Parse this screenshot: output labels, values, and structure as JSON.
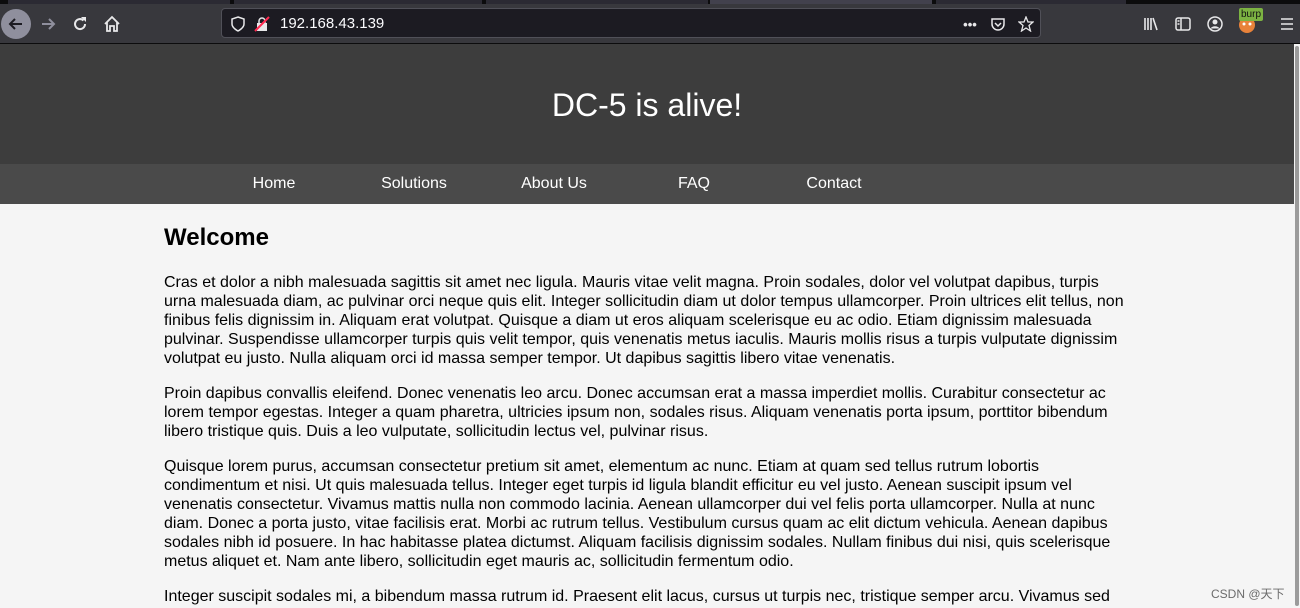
{
  "browser": {
    "url": "192.168.43.139",
    "extension_badge": "burp",
    "colors": {
      "chrome": "#38383d",
      "urlbar": "#1c1b22"
    }
  },
  "site": {
    "title": "DC-5 is alive!",
    "nav": [
      "Home",
      "Solutions",
      "About Us",
      "FAQ",
      "Contact"
    ],
    "colors": {
      "header": "#3d3d3d",
      "nav": "#4a4a4a",
      "body": "#f5f5f5"
    }
  },
  "content": {
    "heading": "Welcome",
    "paragraphs": [
      "Cras et dolor a nibh malesuada sagittis sit amet nec ligula. Mauris vitae velit magna. Proin sodales, dolor vel volutpat dapibus, turpis urna malesuada diam, ac pulvinar orci neque quis elit. Integer sollicitudin diam ut dolor tempus ullamcorper. Proin ultrices elit tellus, non finibus felis dignissim in. Aliquam erat volutpat. Quisque a diam ut eros aliquam scelerisque eu ac odio. Etiam dignissim malesuada pulvinar. Suspendisse ullamcorper turpis quis velit tempor, quis venenatis metus iaculis. Mauris mollis risus a turpis vulputate dignissim volutpat eu justo. Nulla aliquam orci id massa semper tempor. Ut dapibus sagittis libero vitae venenatis.",
      "Proin dapibus convallis eleifend. Donec venenatis leo arcu. Donec accumsan erat a massa imperdiet mollis. Curabitur consectetur ac lorem tempor egestas. Integer a quam pharetra, ultricies ipsum non, sodales risus. Aliquam venenatis porta ipsum, porttitor bibendum libero tristique quis. Duis a leo vulputate, sollicitudin lectus vel, pulvinar risus.",
      "Quisque lorem purus, accumsan consectetur pretium sit amet, elementum ac nunc. Etiam at quam sed tellus rutrum lobortis condimentum et nisi. Ut quis malesuada tellus. Integer eget turpis id ligula blandit efficitur eu vel justo. Aenean suscipit ipsum vel venenatis consectetur. Vivamus mattis nulla non commodo lacinia. Aenean ullamcorper dui vel felis porta ullamcorper. Nulla at nunc diam. Donec a porta justo, vitae facilisis erat. Morbi ac rutrum tellus. Vestibulum cursus quam ac elit dictum vehicula. Aenean dapibus sodales nibh id posuere. In hac habitasse platea dictumst. Aliquam facilisis dignissim sodales. Nullam finibus dui nisi, quis scelerisque metus aliquet et. Nam ante libero, sollicitudin eget mauris ac, sollicitudin fermentum odio.",
      "Integer suscipit sodales mi, a bibendum massa rutrum id. Praesent elit lacus, cursus ut turpis nec, tristique semper arcu. Vivamus sed"
    ]
  },
  "watermark": "CSDN @天下"
}
